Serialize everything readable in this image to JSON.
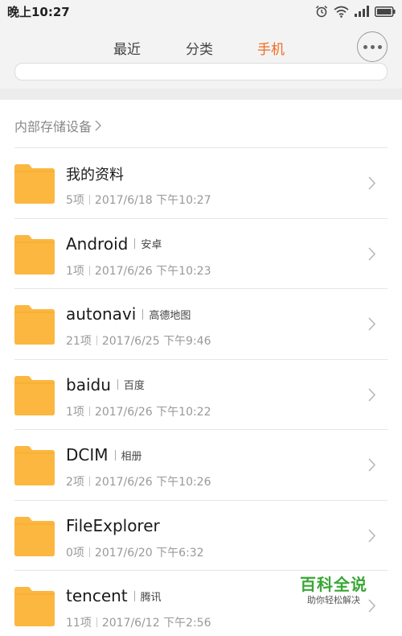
{
  "status_bar": {
    "time": "晚上10:27",
    "icons": [
      "alarm-icon",
      "wifi-icon",
      "signal-icon",
      "battery-icon"
    ]
  },
  "tabs": [
    {
      "label": "最近",
      "active": false
    },
    {
      "label": "分类",
      "active": false
    },
    {
      "label": "手机",
      "active": true
    }
  ],
  "accent_color": "#f26b21",
  "folder_color": "#fbb740",
  "breadcrumb": {
    "label": "内部存储设备"
  },
  "folders": [
    {
      "name": "我的资料",
      "alias": "",
      "count": "5项",
      "date": "2017/6/18 下午10:27"
    },
    {
      "name": "Android",
      "alias": "安卓",
      "count": "1项",
      "date": "2017/6/26 下午10:23"
    },
    {
      "name": "autonavi",
      "alias": "高德地图",
      "count": "21项",
      "date": "2017/6/25 下午9:46"
    },
    {
      "name": "baidu",
      "alias": "百度",
      "count": "1项",
      "date": "2017/6/26 下午10:22"
    },
    {
      "name": "DCIM",
      "alias": "相册",
      "count": "2项",
      "date": "2017/6/26 下午10:26"
    },
    {
      "name": "FileExplorer",
      "alias": "",
      "count": "0项",
      "date": "2017/6/20 下午6:32"
    },
    {
      "name": "tencent",
      "alias": "腾讯",
      "count": "11项",
      "date": "2017/6/12 下午2:56"
    }
  ],
  "watermark": {
    "title": "百科全说",
    "subtitle": "助你轻松解决"
  }
}
